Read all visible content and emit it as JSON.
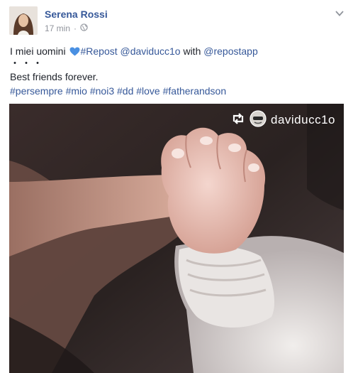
{
  "post": {
    "author": "Serena Rossi",
    "time": "17 min",
    "separator": "·",
    "line1_prefix": "I miei uomini ",
    "line1_tag": "#Repost",
    "line1_user1": "@daviducc1o",
    "line1_with": " with ",
    "line1_user2": "@repostapp",
    "dots": "・・・",
    "line3": "Best friends forever.",
    "hashtags": [
      "#persempre",
      "#mio",
      "#noi3",
      "#dd",
      "#love",
      "#fatherandson"
    ]
  },
  "photo": {
    "watermark_user": "daviducc1o"
  },
  "icons": {
    "privacy": "globe-icon",
    "menu": "chevron-down-icon",
    "heart": "blue-heart-icon",
    "repost": "repost-icon"
  },
  "colors": {
    "link": "#365899",
    "meta": "#90949c",
    "heart": "#4a90e2"
  }
}
